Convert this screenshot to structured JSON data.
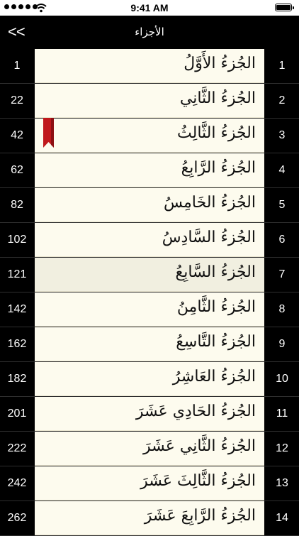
{
  "status_bar": {
    "time": "9:41 AM",
    "signal_icon": "signal-dots-icon",
    "wifi_icon": "wifi-icon",
    "battery_icon": "battery-icon",
    "battery_level": 1.0
  },
  "nav": {
    "back_label": "<<",
    "title": "الأجزاء"
  },
  "colors": {
    "row_bg": "#fdfbee",
    "row_selected_bg": "#f1efe0",
    "side_bg": "#000000",
    "bookmark": "#c0181c"
  },
  "juz_list": [
    {
      "juz": "1",
      "name": "الجُزءُ الأَوَّلُ",
      "page": "1"
    },
    {
      "juz": "2",
      "name": "الجُزءُ الثَّانِي",
      "page": "22"
    },
    {
      "juz": "3",
      "name": "الجُزءُ الثَّالِثُ",
      "page": "42",
      "bookmarked": true
    },
    {
      "juz": "4",
      "name": "الجُزءُ الرَّابِعُ",
      "page": "62"
    },
    {
      "juz": "5",
      "name": "الجُزءُ الخَامِسُ",
      "page": "82"
    },
    {
      "juz": "6",
      "name": "الجُزءُ السَّادِسُ",
      "page": "102"
    },
    {
      "juz": "7",
      "name": "الجُزءُ السَّابِعُ",
      "page": "121",
      "selected": true
    },
    {
      "juz": "8",
      "name": "الجُزءُ الثَّامِنُ",
      "page": "142"
    },
    {
      "juz": "9",
      "name": "الجُزءُ التَّاسِعُ",
      "page": "162"
    },
    {
      "juz": "10",
      "name": "الجُزءُ العَاشِرُ",
      "page": "182"
    },
    {
      "juz": "11",
      "name": "الجُزءُ الحَادِي عَشَرَ",
      "page": "201"
    },
    {
      "juz": "12",
      "name": "الجُزءُ الثَّانِي عَشَرَ",
      "page": "222"
    },
    {
      "juz": "13",
      "name": "الجُزءُ الثَّالِثَ عَشَرَ",
      "page": "242"
    },
    {
      "juz": "14",
      "name": "الجُزءُ الرَّابِعَ عَشَرَ",
      "page": "262"
    }
  ]
}
